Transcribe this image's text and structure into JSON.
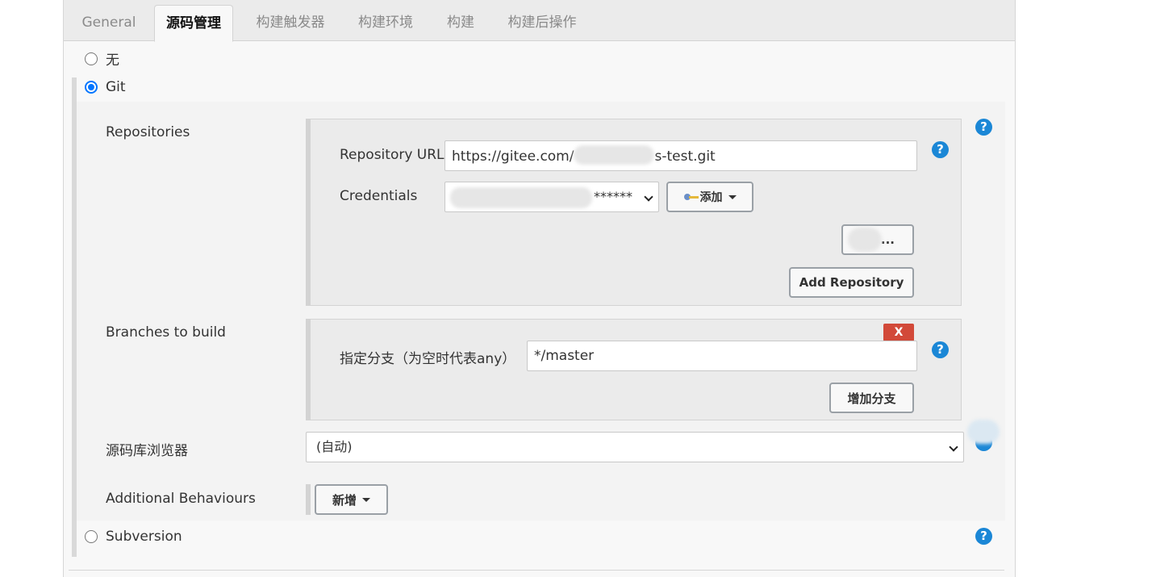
{
  "tabs": [
    {
      "label": "General",
      "active": false
    },
    {
      "label": "源码管理",
      "active": true
    },
    {
      "label": "构建触发器",
      "active": false
    },
    {
      "label": "构建环境",
      "active": false
    },
    {
      "label": "构建",
      "active": false
    },
    {
      "label": "构建后操作",
      "active": false
    }
  ],
  "scm_options": {
    "none": "无",
    "git": "Git",
    "subversion": "Subversion"
  },
  "repositories": {
    "label": "Repositories",
    "url_label": "Repository URL",
    "url_value_prefix": "https://gitee.com/",
    "url_value_suffix": "s-test.git",
    "credentials_label": "Credentials",
    "credentials_value": "******",
    "add_button": "添加",
    "advanced_button": "...",
    "add_repository_button": "Add Repository"
  },
  "branches": {
    "label": "Branches to build",
    "delete_button": "X",
    "specifier_label": "指定分支（为空时代表any）",
    "specifier_value": "*/master",
    "add_branch_button": "增加分支"
  },
  "browser": {
    "label": "源码库浏览器",
    "selected": "(自动)"
  },
  "additional": {
    "label": "Additional Behaviours",
    "add_button": "新增"
  },
  "help_icon_text": "?",
  "colors": {
    "accent": "#0075ff",
    "help": "#1b87d6",
    "delete": "#d24939"
  }
}
